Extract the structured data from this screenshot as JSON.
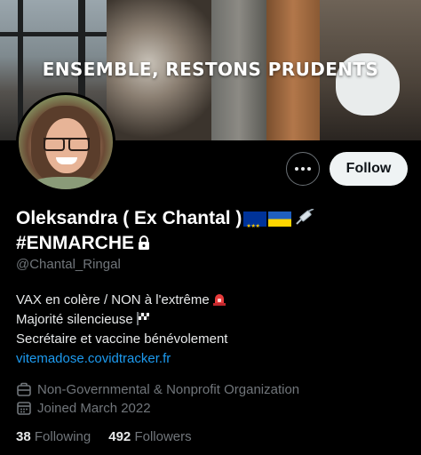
{
  "banner": {
    "text": "ENSEMBLE, RESTONS PRUDENTS"
  },
  "profile": {
    "name_line1": "Oleksandra ( Ex Chantal )",
    "name_line2": "#ENMARCHE",
    "handle": "@Chantal_Ringal",
    "bio": [
      "VAX en colère / NON à l'extrême",
      "Majorité silencieuse",
      "Secrétaire et vaccine bénévolement"
    ],
    "link": "vitemadose.covidtracker.fr",
    "category": "Non-Governmental & Nonprofit Organization",
    "joined": "Joined March 2022",
    "following_count": "38",
    "following_label": "Following",
    "followers_count": "492",
    "followers_label": "Followers"
  },
  "actions": {
    "follow_label": "Follow"
  },
  "icons": [
    "more-icon",
    "eu-flag-icon",
    "ukraine-flag-icon",
    "syringe-icon",
    "lock-icon",
    "siren-icon",
    "checkered-flag-icon",
    "briefcase-icon",
    "calendar-icon"
  ],
  "colors": {
    "background": "#000000",
    "text": "#e7e9ea",
    "muted": "#71767b",
    "link": "#1d9bf0",
    "follow_button": "#eff3f4"
  }
}
